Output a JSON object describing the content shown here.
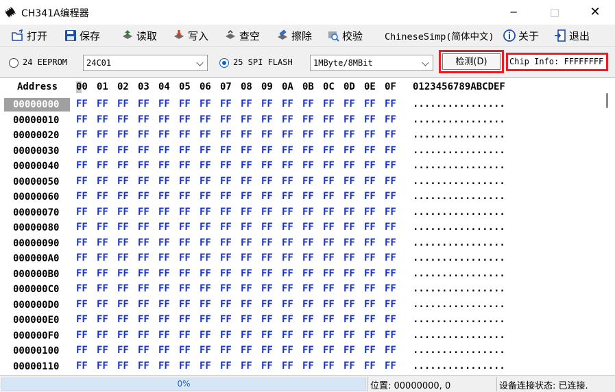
{
  "window": {
    "title": "CH341A编程器"
  },
  "toolbar": {
    "open": "打开",
    "save": "保存",
    "read": "读取",
    "write": "写入",
    "blank_check": "查空",
    "erase": "擦除",
    "verify": "校验",
    "language": "ChineseSimp(简体中文)",
    "about": "关于",
    "exit": "退出"
  },
  "options": {
    "eeprom_label": "24 EEPROM",
    "eeprom_selected": false,
    "eeprom_model": "24C01",
    "spi_label": "25 SPI FLASH",
    "spi_selected": true,
    "spi_size": "1MByte/8MBit",
    "detect_button": "检测(D)",
    "chip_info": "Chip Info: FFFFFFFF"
  },
  "hexview": {
    "address_header": "Address",
    "column_headers": [
      "00",
      "01",
      "02",
      "03",
      "04",
      "05",
      "06",
      "07",
      "08",
      "09",
      "0A",
      "0B",
      "0C",
      "0D",
      "0E",
      "0F"
    ],
    "ascii_header": "0123456789ABCDEF",
    "selected_row": 0,
    "rows": [
      {
        "address": "00000000",
        "ascii": "................"
      },
      {
        "address": "00000010",
        "ascii": "................"
      },
      {
        "address": "00000020",
        "ascii": "................"
      },
      {
        "address": "00000030",
        "ascii": "................"
      },
      {
        "address": "00000040",
        "ascii": "................"
      },
      {
        "address": "00000050",
        "ascii": "................"
      },
      {
        "address": "00000060",
        "ascii": "................"
      },
      {
        "address": "00000070",
        "ascii": "................"
      },
      {
        "address": "00000080",
        "ascii": "................"
      },
      {
        "address": "00000090",
        "ascii": "................"
      },
      {
        "address": "000000A0",
        "ascii": "................"
      },
      {
        "address": "000000B0",
        "ascii": "................"
      },
      {
        "address": "000000C0",
        "ascii": "................"
      },
      {
        "address": "000000D0",
        "ascii": "................"
      },
      {
        "address": "000000E0",
        "ascii": "................"
      },
      {
        "address": "000000F0",
        "ascii": "................"
      },
      {
        "address": "00000100",
        "ascii": "................"
      },
      {
        "address": "00000110",
        "ascii": "................"
      }
    ],
    "byte_value": "FF"
  },
  "status": {
    "progress_text": "0%",
    "progress_value": 0,
    "position": "位置: 00000000, 0",
    "connection": "设备连接状态: 已连接."
  },
  "colors": {
    "hex_bytes": "#1a33c8",
    "highlight_border": "#ee1c24",
    "selected_address_bg": "#a0a0a0",
    "progress_text": "#2a62b8"
  }
}
